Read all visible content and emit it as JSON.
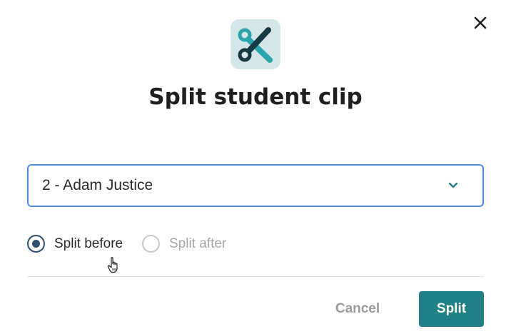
{
  "dialog": {
    "title": "Split student clip",
    "close_icon": "close-icon",
    "app_icon": "scissors-icon",
    "colors": {
      "accent": "#217f86",
      "focus_border": "#4a8fdd",
      "radio_selected": "#2d4f73",
      "icon_bg": "#d5e6e8",
      "icon_teal": "#2aa4ad",
      "icon_dark": "#163a44"
    }
  },
  "select": {
    "value": "2 - Adam Justice",
    "chevron_icon": "chevron-down-icon"
  },
  "radios": {
    "split_before": {
      "label": "Split before",
      "checked": true
    },
    "split_after": {
      "label": "Split after",
      "checked": false
    }
  },
  "footer": {
    "cancel_label": "Cancel",
    "split_label": "Split"
  }
}
